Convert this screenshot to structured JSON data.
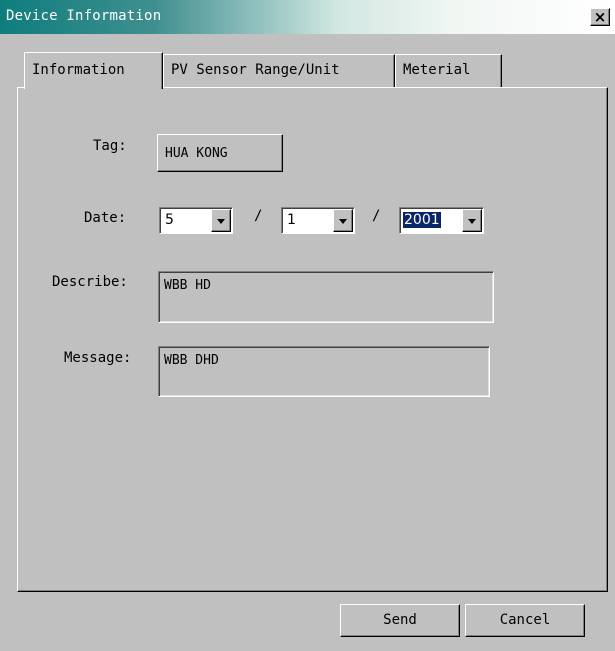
{
  "window": {
    "title": "Device Information",
    "close_glyph": "×",
    "title_bar_color": "#0f7d7d"
  },
  "tabs": [
    {
      "label": "Information",
      "selected": true
    },
    {
      "label": "PV Sensor Range/Unit",
      "selected": false
    },
    {
      "label": "Meterial",
      "selected": false
    }
  ],
  "form": {
    "tag": {
      "label": "Tag:",
      "value": "HUA KONG"
    },
    "date": {
      "label": "Date:",
      "separator": "/",
      "month": "5",
      "day": "1",
      "year": "2001"
    },
    "describe": {
      "label": "Describe:",
      "value": "WBB HD"
    },
    "message": {
      "label": "Message:",
      "value": "WBB DHD"
    }
  },
  "buttons": {
    "send": "Send",
    "cancel": "Cancel"
  },
  "icons": {
    "close": "close-icon",
    "dropdown": "chevron-down-icon"
  }
}
